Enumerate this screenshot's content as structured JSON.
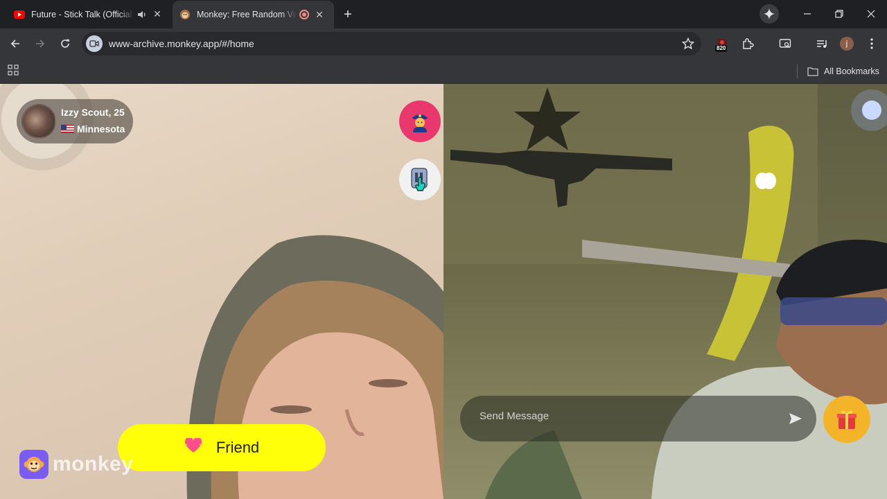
{
  "browser": {
    "tabs": [
      {
        "title": "Future - Stick Talk (Official Music Video)",
        "favicon": "youtube-icon",
        "audio": true
      },
      {
        "title": "Monkey: Free Random Video Chat",
        "favicon": "monkey-icon",
        "recording": true
      }
    ],
    "url": "www-archive.monkey.app/#/home",
    "extension_badge": "820",
    "profile_initial": "j",
    "bookmarks_label": "All Bookmarks"
  },
  "call": {
    "partner": {
      "name_age": "Izzy Scout, 25",
      "location": "Minnesota",
      "flag": "us-flag-icon"
    },
    "report_icon": "police-officer-icon",
    "next_icon": "skip-icon",
    "friend_label": "Friend",
    "friend_icon": "heart-icon",
    "brand": "monkey",
    "chat_placeholder": "Send Message",
    "gift_icon": "gift-icon"
  },
  "colors": {
    "friend_button": "#ffff0a",
    "report_button": "#e8386d",
    "gift_button": "#f4b42a",
    "brand_purple": "#7b5cf0"
  }
}
